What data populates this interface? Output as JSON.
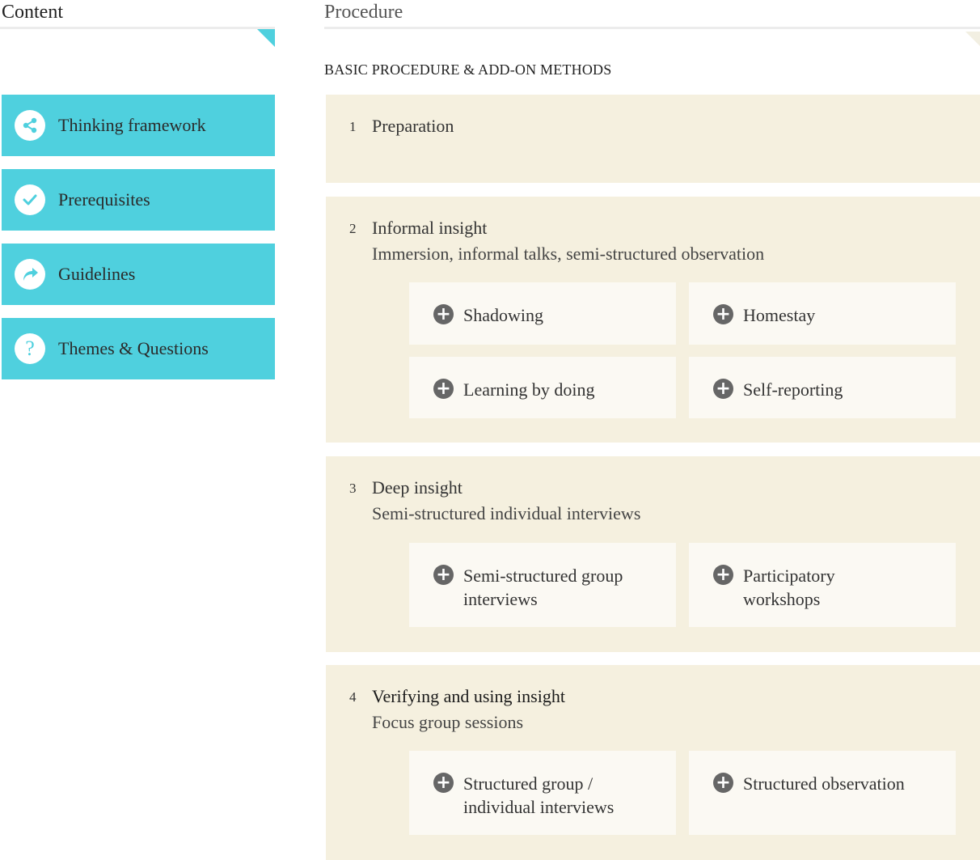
{
  "left": {
    "header": "Content",
    "menu": [
      {
        "label": "Thinking framework",
        "icon": "share-icon"
      },
      {
        "label": "Prerequisites",
        "icon": "check-icon"
      },
      {
        "label": "Guidelines",
        "icon": "forward-arrow-icon"
      },
      {
        "label": "Themes & Questions",
        "icon": "question-icon"
      }
    ]
  },
  "right": {
    "header": "Procedure",
    "section_label": "BASIC PROCEDURE & ADD-ON METHODS",
    "steps": [
      {
        "number": "1",
        "title": "Preparation",
        "subtitle": "",
        "addons": []
      },
      {
        "number": "2",
        "title": "Informal insight",
        "subtitle": "Immersion, informal talks, semi-structured observation",
        "addons": [
          "Shadowing",
          "Homestay",
          "Learning by doing",
          "Self-reporting"
        ]
      },
      {
        "number": "3",
        "title": "Deep insight",
        "subtitle": "Semi-structured individual interviews",
        "addons": [
          "Semi-structured group interviews",
          "Participatory workshops"
        ]
      },
      {
        "number": "4",
        "title": "Verifying and using insight",
        "subtitle": "Focus group sessions",
        "addons": [
          "Structured group / individual interviews",
          "Structured observation"
        ]
      }
    ]
  },
  "colors": {
    "accent": "#4fd0de",
    "step_bg": "#f5f0df",
    "addon_bg": "#fbf9f3",
    "plus_icon": "#666666"
  }
}
